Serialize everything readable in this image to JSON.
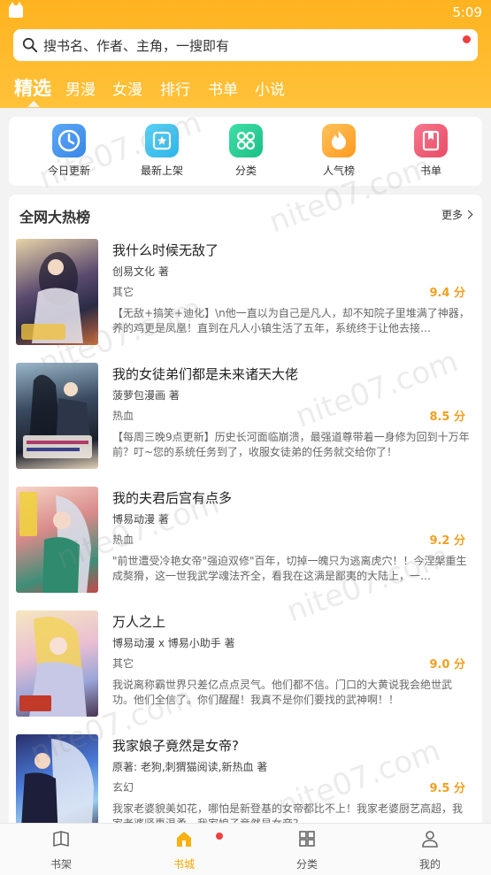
{
  "status": {
    "time": "5:09"
  },
  "search": {
    "placeholder": "搜书名、作者、主角，一搜即有"
  },
  "tabs": [
    {
      "label": "精选"
    },
    {
      "label": "男漫"
    },
    {
      "label": "女漫"
    },
    {
      "label": "排行"
    },
    {
      "label": "书单"
    },
    {
      "label": "小说"
    }
  ],
  "quicknav": [
    {
      "label": "今日更新",
      "icon": "clock-icon",
      "color": "#4a9bf0"
    },
    {
      "label": "最新上架",
      "icon": "new-shelf-icon",
      "color": "#3cc4ef"
    },
    {
      "label": "分类",
      "icon": "category-icon",
      "color": "#2ed19a"
    },
    {
      "label": "人气榜",
      "icon": "flame-icon",
      "color": "#ffae3a"
    },
    {
      "label": "书单",
      "icon": "booklist-icon",
      "color": "#f0607a"
    }
  ],
  "ranking": {
    "title": "全网大热榜",
    "more": "更多",
    "books": [
      {
        "title": "我什么时候无敌了",
        "author": "创易文化 著",
        "genre": "其它",
        "score": "9.4 分",
        "desc": "【无敌+搞笑+迪化】\\n他一直以为自己是凡人，却不知院子里堆满了神器，养的鸡更是凤凰！直到在凡人小镇生活了五年，系统终于让他去接…"
      },
      {
        "title": "我的女徒弟们都是未来诸天大佬",
        "author": "菠萝包漫画 著",
        "genre": "热血",
        "score": "8.5 分",
        "desc": "【每周三晚9点更新】历史长河面临崩溃，最强道尊带着一身修为回到十万年前？叮~您的系统任务到了，收服女徒弟的任务就交给你了！"
      },
      {
        "title": "我的夫君后宫有点多",
        "author": "博易动漫 著",
        "genre": "热血",
        "score": "9.2 分",
        "desc": "\"前世遭受冷艳女帝\"强迫双修\"百年，切掉一魄只为逃离虎穴！！今涅槃重生成獒猾，这一世我武学魂法齐全，看我在这满是鄙夷的大陆上，一…"
      },
      {
        "title": "万人之上",
        "author": "博易动漫 x 博易小助手 著",
        "genre": "其它",
        "score": "9.0 分",
        "desc": "我说离称霸世界只差亿点点灵气。他们都不信。门口的大黄说我会绝世武功。他们全信了。你们醒醒！我真不是你们要找的武神啊！！"
      },
      {
        "title": "我家娘子竟然是女帝?",
        "author": "原著: 老狗,刺猬猫阅读,新热血 著",
        "genre": "玄幻",
        "score": "9.5 分",
        "desc": "我家老婆貌美如花，哪怕是新登基的女帝都比不上！我家老婆厨艺高超，我家老婆贤惠温柔，我家娘子竟然是女帝？"
      }
    ]
  },
  "bottomnav": [
    {
      "label": "书架",
      "icon": "bookshelf-icon"
    },
    {
      "label": "书城",
      "icon": "bookstore-icon"
    },
    {
      "label": "分类",
      "icon": "grid-icon"
    },
    {
      "label": "我的",
      "icon": "profile-icon"
    }
  ],
  "watermark": {
    "text": "nite07.com"
  }
}
